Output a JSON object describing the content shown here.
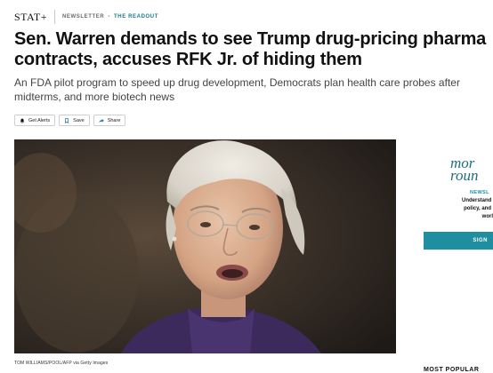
{
  "header": {
    "logo": "STAT+",
    "section": "NEWSLETTER",
    "separator": "•",
    "newsletter_name": "THE READOUT"
  },
  "article": {
    "headline": "Sen. Warren demands to see Trump drug-pricing pharma contracts, accuses RFK Jr. of hiding them",
    "dek": "An FDA pilot program to speed up drug development, Democrats plan health care probes after midterms, and more biotech news",
    "photo_credit": "TOM WILLIAMS/POOL/AFP via Getty Images"
  },
  "actions": [
    {
      "label": "Get Alerts",
      "icon": "bell-icon"
    },
    {
      "label": "Save",
      "icon": "bookmark-icon"
    },
    {
      "label": "Share",
      "icon": "share-arrow-icon"
    }
  ],
  "sidebar": {
    "promo_title": "mor\nroun",
    "promo_label": "NEWSL",
    "promo_text": "Understand how\npolicy, and med\nworld ev",
    "promo_button": "SIGN",
    "most_popular": "MOST POPULAR"
  },
  "colors": {
    "accent": "#1e8ea0",
    "text": "#111111",
    "muted": "#444444"
  }
}
